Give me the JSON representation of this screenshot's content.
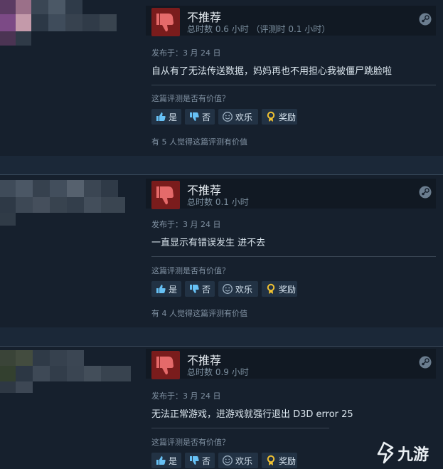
{
  "reviews": [
    {
      "verdict": "不推荐",
      "hours": "总时数 0.6 小时 （评测时 0.1 小时）",
      "posted": "发布于：3 月 24 日",
      "content": "自从有了无法传送数据，妈妈再也不用担心我被僵尸跳脸啦",
      "helpful_question": "这篇评测是否有价值？",
      "buttons": {
        "yes": "是",
        "no": "否",
        "funny": "欢乐",
        "award": "奖励"
      },
      "helpful_count": "有 5 人觉得这篇评测有价值"
    },
    {
      "verdict": "不推荐",
      "hours": "总时数 0.1 小时",
      "posted": "发布于：3 月 24 日",
      "content": "一直显示有错误发生 进不去",
      "helpful_question": "这篇评测是否有价值？",
      "buttons": {
        "yes": "是",
        "no": "否",
        "funny": "欢乐",
        "award": "奖励"
      },
      "helpful_count": "有 4 人觉得这篇评测有价值"
    },
    {
      "verdict": "不推荐",
      "hours": "总时数 0.9 小时",
      "posted": "发布于：3 月 24 日",
      "content": "无法正常游戏，进游戏就强行退出 D3D error 25",
      "helpful_question": "这篇评测是否有价值？",
      "buttons": {
        "yes": "是",
        "no": "否",
        "funny": "欢乐",
        "award": "奖励"
      }
    }
  ],
  "watermark": {
    "text": "九游"
  },
  "icons": [
    "thumbs-down-icon",
    "thumbs-up-icon",
    "smiley-icon",
    "award-icon",
    "steam-icon"
  ],
  "colors": {
    "background": "#1b2838",
    "review_bg": "#16202d",
    "thumb_box": "#7a1c1c",
    "button_bg": "#223244"
  }
}
